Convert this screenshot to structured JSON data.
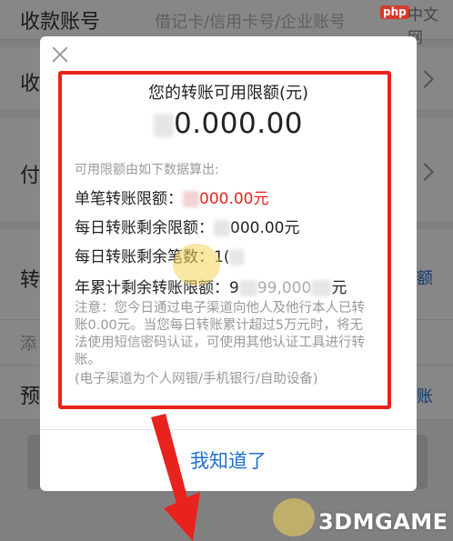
{
  "form": {
    "account_label": "收款账号",
    "account_hint": "借记卡/信用卡号/企业账号",
    "row2_label": "收",
    "row3_label": "付",
    "row4_label": "转",
    "row4_link": "额",
    "row5_label": "添",
    "row6_label": "预",
    "row6_link": "账"
  },
  "watermark_top": {
    "badge": "php",
    "site": "中文网"
  },
  "dialog": {
    "title": "您的转账可用限额(元)",
    "amount_visible": "0.000.00",
    "subtitle": "可用限额由如下数据算出:",
    "single_label": "单笔转账限额：",
    "single_value_visible": "000.00元",
    "daily_remaining_label": "每日转账剩余限额：",
    "daily_remaining_value_visible": "000.00元",
    "daily_count_label": "每日转账剩余笔数：",
    "daily_count_value_visible": "1(",
    "yearly_label": "年累计剩余转账限额：",
    "yearly_value_prefix": "9",
    "yearly_value_mid": "99,000",
    "yearly_value_suffix": "元",
    "notice_1": "注意：您今日通过电子渠道向他人及他行本人已转账0.00元。当您每日转账累计超过5万元时，将无法使用短信密码认证，可使用其他认证工具进行转账。",
    "notice_2": "(电子渠道为个人网银/手机银行/自助设备)",
    "confirm_label": "我知道了"
  },
  "watermark_bottom": {
    "brand": "3DMGAME"
  },
  "colors": {
    "highlight": "#e8231d",
    "link": "#1f6fd1",
    "overlay": "rgba(0,0,0,0.47)"
  }
}
